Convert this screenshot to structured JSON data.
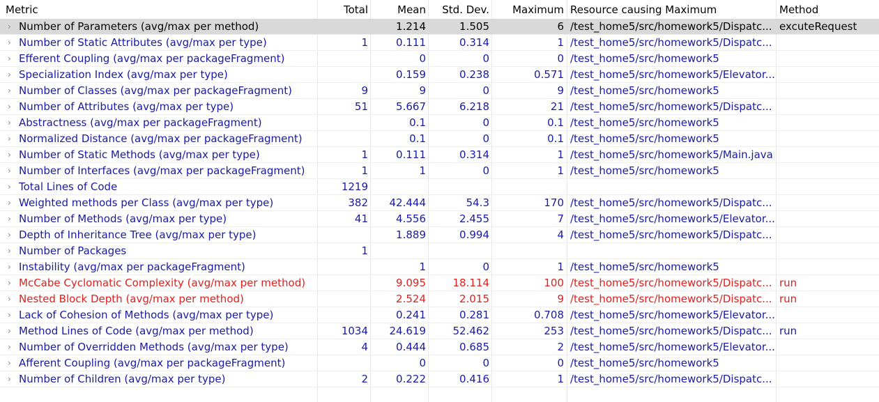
{
  "columns": {
    "metric": "Metric",
    "total": "Total",
    "mean": "Mean",
    "std": "Std. Dev.",
    "max": "Maximum",
    "resource": "Resource causing Maximum",
    "method": "Method"
  },
  "colors": {
    "normal_text": "#1a1aa6",
    "warning_text": "#e0201f",
    "selected_text": "#000000",
    "selected_background": "#d9d9d9",
    "expand_arrow": "#888888"
  },
  "expand_icon": "chevron-right-icon",
  "rows": [
    {
      "metric": "Number of Parameters (avg/max per method)",
      "total": "",
      "mean": "1.214",
      "std": "1.505",
      "max": "6",
      "resource": "/test_home5/src/homework5/Dispatc...",
      "method": "excuteRequest",
      "status": "selected"
    },
    {
      "metric": "Number of Static Attributes (avg/max per type)",
      "total": "1",
      "mean": "0.111",
      "std": "0.314",
      "max": "1",
      "resource": "/test_home5/src/homework5/Dispatc...",
      "method": "",
      "status": "normal"
    },
    {
      "metric": "Efferent Coupling (avg/max per packageFragment)",
      "total": "",
      "mean": "0",
      "std": "0",
      "max": "0",
      "resource": "/test_home5/src/homework5",
      "method": "",
      "status": "normal"
    },
    {
      "metric": "Specialization Index (avg/max per type)",
      "total": "",
      "mean": "0.159",
      "std": "0.238",
      "max": "0.571",
      "resource": "/test_home5/src/homework5/Elevator...",
      "method": "",
      "status": "normal"
    },
    {
      "metric": "Number of Classes (avg/max per packageFragment)",
      "total": "9",
      "mean": "9",
      "std": "0",
      "max": "9",
      "resource": "/test_home5/src/homework5",
      "method": "",
      "status": "normal"
    },
    {
      "metric": "Number of Attributes (avg/max per type)",
      "total": "51",
      "mean": "5.667",
      "std": "6.218",
      "max": "21",
      "resource": "/test_home5/src/homework5/Dispatc...",
      "method": "",
      "status": "normal"
    },
    {
      "metric": "Abstractness (avg/max per packageFragment)",
      "total": "",
      "mean": "0.1",
      "std": "0",
      "max": "0.1",
      "resource": "/test_home5/src/homework5",
      "method": "",
      "status": "normal"
    },
    {
      "metric": "Normalized Distance (avg/max per packageFragment)",
      "total": "",
      "mean": "0.1",
      "std": "0",
      "max": "0.1",
      "resource": "/test_home5/src/homework5",
      "method": "",
      "status": "normal"
    },
    {
      "metric": "Number of Static Methods (avg/max per type)",
      "total": "1",
      "mean": "0.111",
      "std": "0.314",
      "max": "1",
      "resource": "/test_home5/src/homework5/Main.java",
      "method": "",
      "status": "normal"
    },
    {
      "metric": "Number of Interfaces (avg/max per packageFragment)",
      "total": "1",
      "mean": "1",
      "std": "0",
      "max": "1",
      "resource": "/test_home5/src/homework5",
      "method": "",
      "status": "normal"
    },
    {
      "metric": "Total Lines of Code",
      "total": "1219",
      "mean": "",
      "std": "",
      "max": "",
      "resource": "",
      "method": "",
      "status": "normal"
    },
    {
      "metric": "Weighted methods per Class (avg/max per type)",
      "total": "382",
      "mean": "42.444",
      "std": "54.3",
      "max": "170",
      "resource": "/test_home5/src/homework5/Dispatc...",
      "method": "",
      "status": "normal"
    },
    {
      "metric": "Number of Methods (avg/max per type)",
      "total": "41",
      "mean": "4.556",
      "std": "2.455",
      "max": "7",
      "resource": "/test_home5/src/homework5/Elevator...",
      "method": "",
      "status": "normal"
    },
    {
      "metric": "Depth of Inheritance Tree (avg/max per type)",
      "total": "",
      "mean": "1.889",
      "std": "0.994",
      "max": "4",
      "resource": "/test_home5/src/homework5/Dispatc...",
      "method": "",
      "status": "normal"
    },
    {
      "metric": "Number of Packages",
      "total": "1",
      "mean": "",
      "std": "",
      "max": "",
      "resource": "",
      "method": "",
      "status": "normal"
    },
    {
      "metric": "Instability (avg/max per packageFragment)",
      "total": "",
      "mean": "1",
      "std": "0",
      "max": "1",
      "resource": "/test_home5/src/homework5",
      "method": "",
      "status": "normal"
    },
    {
      "metric": "McCabe Cyclomatic Complexity (avg/max per method)",
      "total": "",
      "mean": "9.095",
      "std": "18.114",
      "max": "100",
      "resource": "/test_home5/src/homework5/Dispatc...",
      "method": "run",
      "status": "warning"
    },
    {
      "metric": "Nested Block Depth (avg/max per method)",
      "total": "",
      "mean": "2.524",
      "std": "2.015",
      "max": "9",
      "resource": "/test_home5/src/homework5/Dispatc...",
      "method": "run",
      "status": "warning"
    },
    {
      "metric": "Lack of Cohesion of Methods (avg/max per type)",
      "total": "",
      "mean": "0.241",
      "std": "0.281",
      "max": "0.708",
      "resource": "/test_home5/src/homework5/Elevator...",
      "method": "",
      "status": "normal"
    },
    {
      "metric": "Method Lines of Code (avg/max per method)",
      "total": "1034",
      "mean": "24.619",
      "std": "52.462",
      "max": "253",
      "resource": "/test_home5/src/homework5/Dispatc...",
      "method": "run",
      "status": "normal"
    },
    {
      "metric": "Number of Overridden Methods (avg/max per type)",
      "total": "4",
      "mean": "0.444",
      "std": "0.685",
      "max": "2",
      "resource": "/test_home5/src/homework5/Elevator...",
      "method": "",
      "status": "normal"
    },
    {
      "metric": "Afferent Coupling (avg/max per packageFragment)",
      "total": "",
      "mean": "0",
      "std": "0",
      "max": "0",
      "resource": "/test_home5/src/homework5",
      "method": "",
      "status": "normal"
    },
    {
      "metric": "Number of Children (avg/max per type)",
      "total": "2",
      "mean": "0.222",
      "std": "0.416",
      "max": "1",
      "resource": "/test_home5/src/homework5/Dispatc...",
      "method": "",
      "status": "normal"
    }
  ]
}
